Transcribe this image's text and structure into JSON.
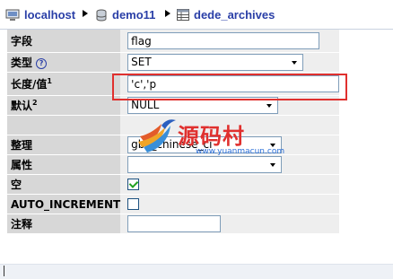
{
  "breadcrumb": {
    "server": "localhost",
    "database": "demo11",
    "table": "dede_archives"
  },
  "form": {
    "field_label": "字段",
    "field_value": "flag",
    "type_label": "类型",
    "type_value": "SET",
    "length_label": "长度/值",
    "length_value": "'c','p",
    "default_label": "默认",
    "default_value": "NULL",
    "collation_label": "整理",
    "collation_value": "gbk_chinese_ci",
    "attributes_label": "属性",
    "attributes_value": "",
    "null_label": "空",
    "null_checked": true,
    "auto_increment_label": "AUTO_INCREMENT",
    "auto_increment_checked": false,
    "comment_label": "注释",
    "comment_value": "",
    "footnote_1": "1",
    "footnote_2": "2",
    "help_glyph": "?"
  },
  "watermark": {
    "text": "源码村",
    "url": "www.yuanmacun.com"
  },
  "colors": {
    "link_blue": "#2a3fa7",
    "label_bg": "#d7d7d7",
    "value_bg": "#eeeeee",
    "highlight_red": "#e0302e"
  }
}
